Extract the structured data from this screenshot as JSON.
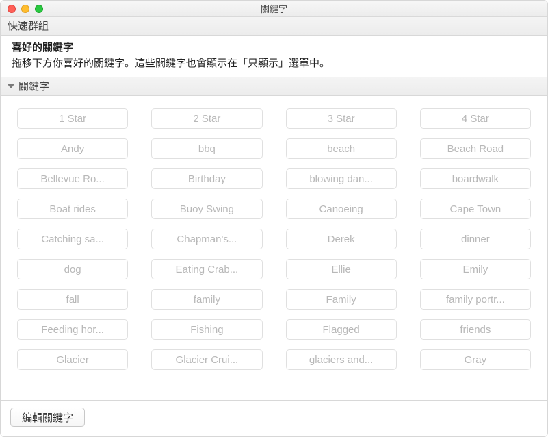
{
  "window": {
    "title": "關鍵字"
  },
  "quickGroup": "快速群組",
  "favorites": {
    "title": "喜好的關鍵字",
    "subtitle": "拖移下方你喜好的關鍵字。這些關鍵字也會顯示在「只顯示」選單中。"
  },
  "section": {
    "label": "關鍵字"
  },
  "keywords": [
    "1 Star",
    "2 Star",
    "3 Star",
    "4 Star",
    "Andy",
    "bbq",
    "beach",
    "Beach Road",
    "Bellevue Ro...",
    "Birthday",
    "blowing dan...",
    "boardwalk",
    "Boat rides",
    "Buoy Swing",
    "Canoeing",
    "Cape Town",
    "Catching sa...",
    "Chapman's...",
    "Derek",
    "dinner",
    "dog",
    "Eating Crab...",
    "Ellie",
    "Emily",
    "fall",
    "family",
    "Family",
    "family portr...",
    "Feeding hor...",
    "Fishing",
    "Flagged",
    "friends",
    "Glacier",
    "Glacier Crui...",
    "glaciers and...",
    "Gray"
  ],
  "footer": {
    "editButton": "編輯關鍵字"
  }
}
